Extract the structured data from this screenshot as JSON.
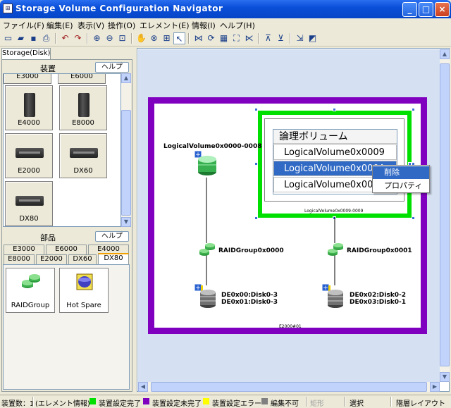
{
  "window": {
    "title": "Storage Volume Configuration Navigator",
    "buttons": {
      "minimize": "_",
      "maximize": "□",
      "close": "×"
    }
  },
  "menu": [
    "ファイル(F)",
    "編集(E)",
    "表示(V)",
    "操作(O)",
    "エレメント(E)",
    "情報(I)",
    "ヘルプ(H)"
  ],
  "left_panel": {
    "tab": "Storage(Disk)",
    "devices": {
      "header": "装置",
      "help": "ヘルプ",
      "partial_top": [
        "E3000",
        "E6000"
      ],
      "tiles": [
        "E4000",
        "E8000",
        "E2000",
        "DX60",
        "DX80"
      ]
    },
    "parts": {
      "header": "部品",
      "help": "ヘルプ",
      "tabs_row1": [
        "E3000",
        "E6000",
        "E4000"
      ],
      "tabs_row2": [
        "E8000",
        "E2000",
        "DX60",
        "DX80"
      ],
      "tiles": [
        "RAIDGroup",
        "Hot Spare"
      ]
    }
  },
  "canvas": {
    "logical_volume_group": "LogicalVolume0x0000-0008",
    "selected_group_label": "LogicalVolume0x0009-0009",
    "raid_groups": [
      {
        "name": "RAIDGroup0x0000",
        "disks": [
          "DE0x00:Disk0-3",
          "DE0x01:Disk0-3"
        ]
      },
      {
        "name": "RAIDGroup0x0001",
        "disks": [
          "DE0x02:Disk0-2",
          "DE0x03:Disk0-1"
        ]
      }
    ],
    "device_label": "E2000#01",
    "popup": {
      "title": "論理ボリューム",
      "items": [
        "LogicalVolume0x0009",
        "LogicalVolume0x000A",
        "LogicalVolume0x000"
      ]
    },
    "context_menu": [
      "削除",
      "プロパティ"
    ]
  },
  "status_bar": {
    "device_count": "装置数：1",
    "element_info": "(エレメント情報)",
    "legend": [
      {
        "label": "装置設定完了",
        "color": "#00e000"
      },
      {
        "label": "装置設定未完了",
        "color": "#8000c0"
      },
      {
        "label": "装置設定エラー",
        "color": "#ffff00"
      },
      {
        "label": "編集不可",
        "color": "#808080"
      }
    ],
    "shape": "矩形",
    "mode": "選択",
    "layout": "階層レイアウト"
  }
}
